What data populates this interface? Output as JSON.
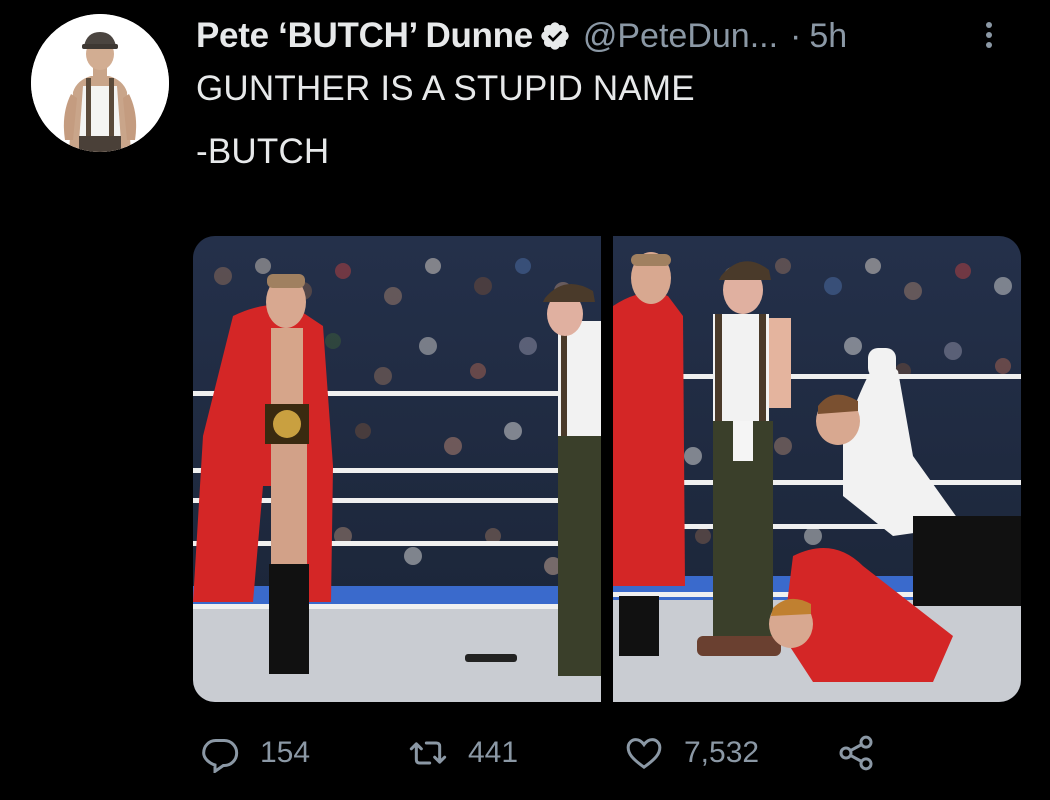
{
  "tweet": {
    "author": {
      "display_name": "Pete ‘BUTCH’ Dunne",
      "handle": "@PeteDun...",
      "verified": true
    },
    "separator": "·",
    "timestamp": "5h",
    "text_lines": [
      "GUNTHER IS A STUPID NAME",
      "-BUTCH"
    ],
    "media": {
      "count": 2
    },
    "stats": {
      "replies": "154",
      "retweets": "441",
      "likes": "7,532"
    }
  },
  "icons": {
    "verified": "verified-badge-icon",
    "more": "more-vertical-icon",
    "reply": "reply-icon",
    "retweet": "retweet-icon",
    "like": "heart-icon",
    "share": "share-icon"
  },
  "colors": {
    "background": "#000000",
    "text_primary": "#e7e9ea",
    "text_secondary": "#8b98a5",
    "verified_badge": "#e7e9ea"
  }
}
